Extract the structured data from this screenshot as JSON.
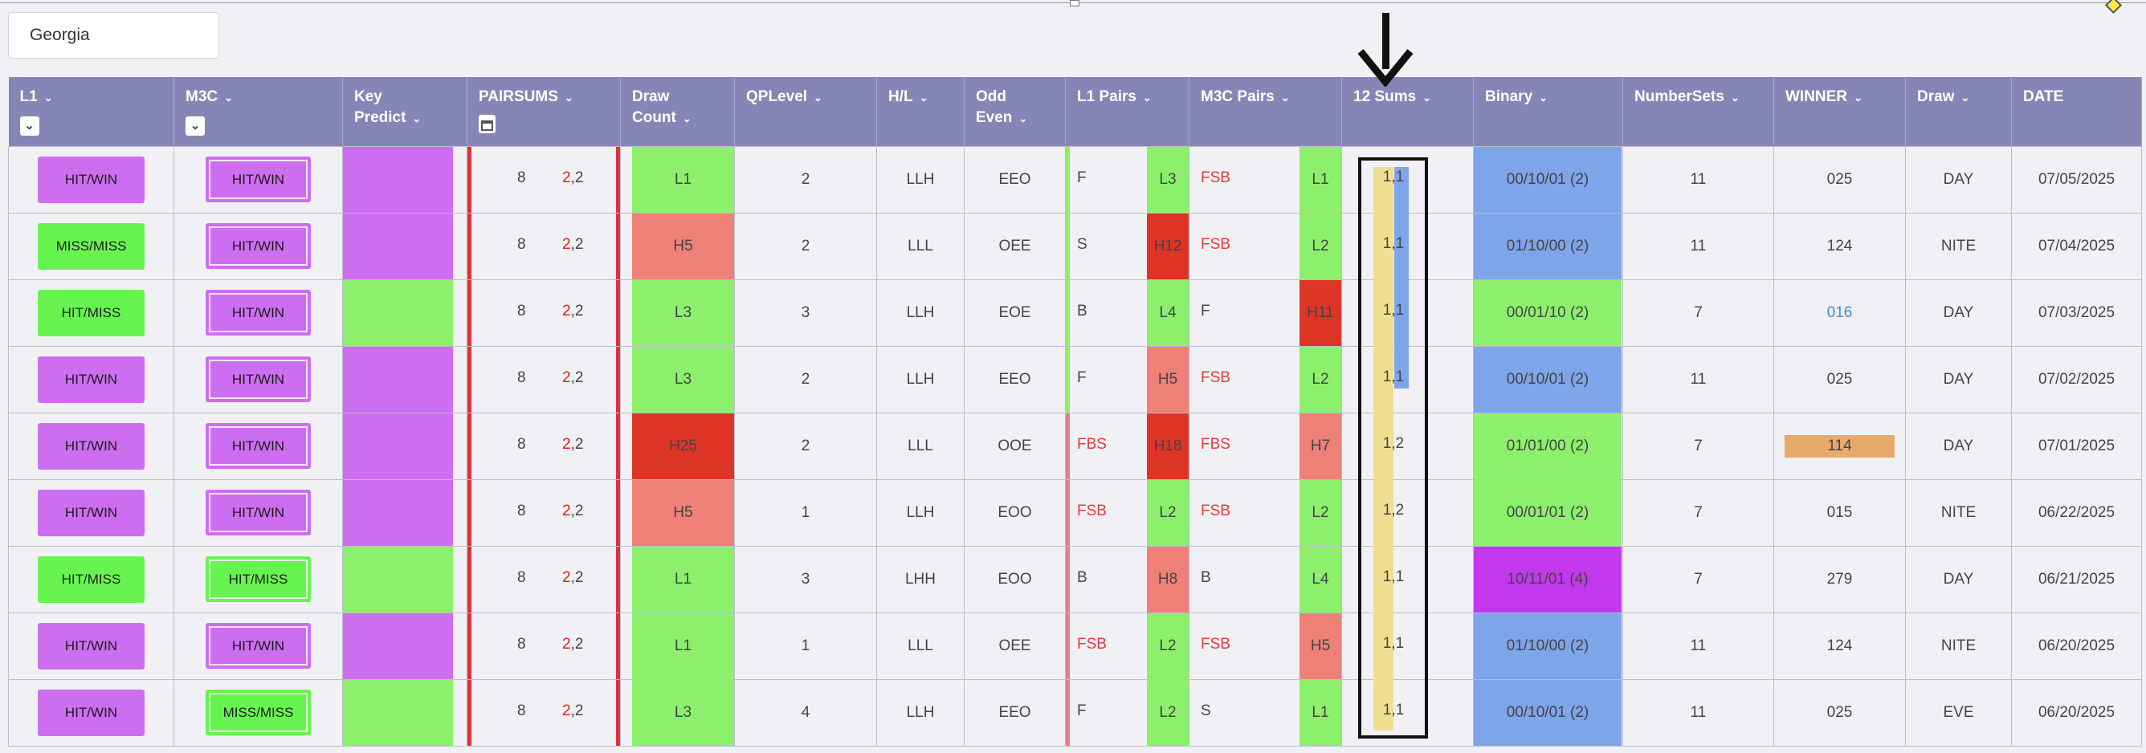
{
  "state_select": {
    "value": "Georgia"
  },
  "headers": [
    {
      "line1": "L1",
      "line2": "",
      "filter": true
    },
    {
      "line1": "M3C",
      "line2": "",
      "filter": true
    },
    {
      "line1": "Key",
      "line2": "Predict"
    },
    {
      "line1": "PAIRSUMS",
      "line2": "",
      "calendar": true
    },
    {
      "line1": "Draw",
      "line2": "Count"
    },
    {
      "line1": "QPLevel",
      "line2": ""
    },
    {
      "line1": "H/L",
      "line2": ""
    },
    {
      "line1": "Odd",
      "line2": "Even"
    },
    {
      "line1": "L1 Pairs",
      "line2": ""
    },
    {
      "line1": "M3C Pairs",
      "line2": ""
    },
    {
      "line1": "12 Sums",
      "line2": ""
    },
    {
      "line1": "Binary",
      "line2": ""
    },
    {
      "line1": "NumberSets",
      "line2": ""
    },
    {
      "line1": "WINNER",
      "line2": ""
    },
    {
      "line1": "Draw",
      "line2": ""
    },
    {
      "line1": "DATE",
      "line2": "",
      "nocaret": true
    }
  ],
  "filter_icon": "chevron-down-icon",
  "calendar_icon": "calendar-icon",
  "rows": [
    {
      "l1": "HIT/WIN",
      "l1c": "purple",
      "m3c": "HIT/WIN",
      "m3cc": "purple",
      "kp": "purple",
      "ps1": "8",
      "ps2a": "2",
      "ps2b": ",2",
      "dc": "L1",
      "dcc": "green",
      "qp": "2",
      "hl": "LLH",
      "oe": "EEO",
      "l1pb": "green",
      "l1p": "F",
      "l1pr": false,
      "l1pv": "L3",
      "l1pvc": "green",
      "m3p": "FSB",
      "m3pr": true,
      "m3pv": "L1",
      "m3pvc": "green",
      "sums": "1,1",
      "bin": "00/10/01 (2)",
      "binc": "blue",
      "ns": "11",
      "win": "025",
      "winc": "",
      "draw": "DAY",
      "date": "07/05/2025"
    },
    {
      "l1": "MISS/MISS",
      "l1c": "green",
      "m3c": "HIT/WIN",
      "m3cc": "purple",
      "kp": "purple",
      "ps1": "8",
      "ps2a": "2",
      "ps2b": ",2",
      "dc": "H5",
      "dcc": "lred",
      "qp": "2",
      "hl": "LLL",
      "oe": "OEE",
      "l1pb": "green",
      "l1p": "S",
      "l1pr": false,
      "l1pv": "H12",
      "l1pvc": "dred",
      "m3p": "FSB",
      "m3pr": true,
      "m3pv": "L2",
      "m3pvc": "green",
      "sums": "1,1",
      "bin": "01/10/00 (2)",
      "binc": "blue",
      "ns": "11",
      "win": "124",
      "winc": "",
      "draw": "NITE",
      "date": "07/04/2025"
    },
    {
      "l1": "HIT/MISS",
      "l1c": "green",
      "m3c": "HIT/WIN",
      "m3cc": "purple",
      "kp": "green",
      "ps1": "8",
      "ps2a": "2",
      "ps2b": ",2",
      "dc": "L3",
      "dcc": "green",
      "qp": "3",
      "hl": "LLH",
      "oe": "EOE",
      "l1pb": "green",
      "l1p": "B",
      "l1pr": false,
      "l1pv": "L4",
      "l1pvc": "green",
      "m3p": "F",
      "m3pr": false,
      "m3pv": "H11",
      "m3pvc": "dred",
      "sums": "1,1",
      "bin": "00/01/10 (2)",
      "binc": "green",
      "ns": "7",
      "win": "016",
      "winc": "link",
      "draw": "DAY",
      "date": "07/03/2025"
    },
    {
      "l1": "HIT/WIN",
      "l1c": "purple",
      "m3c": "HIT/WIN",
      "m3cc": "purple",
      "kp": "purple",
      "ps1": "8",
      "ps2a": "2",
      "ps2b": ",2",
      "dc": "L3",
      "dcc": "green",
      "qp": "2",
      "hl": "LLH",
      "oe": "EEO",
      "l1pb": "green",
      "l1p": "F",
      "l1pr": false,
      "l1pv": "H5",
      "l1pvc": "lred",
      "m3p": "FSB",
      "m3pr": true,
      "m3pv": "L2",
      "m3pvc": "green",
      "sums": "1,1",
      "bin": "00/10/01 (2)",
      "binc": "blue",
      "ns": "11",
      "win": "025",
      "winc": "",
      "draw": "DAY",
      "date": "07/02/2025"
    },
    {
      "l1": "HIT/WIN",
      "l1c": "purple",
      "m3c": "HIT/WIN",
      "m3cc": "purple",
      "kp": "purple",
      "ps1": "8",
      "ps2a": "2",
      "ps2b": ",2",
      "dc": "H25",
      "dcc": "dred",
      "qp": "2",
      "hl": "LLL",
      "oe": "OOE",
      "l1pb": "pink",
      "l1p": "FBS",
      "l1pr": true,
      "l1pv": "H18",
      "l1pvc": "dred",
      "m3p": "FBS",
      "m3pr": true,
      "m3pv": "H7",
      "m3pvc": "lred",
      "sums": "1,2",
      "bin": "01/01/00 (2)",
      "binc": "green",
      "ns": "7",
      "win": "114",
      "winc": "bar",
      "draw": "DAY",
      "date": "07/01/2025"
    },
    {
      "l1": "HIT/WIN",
      "l1c": "purple",
      "m3c": "HIT/WIN",
      "m3cc": "purple",
      "kp": "purple",
      "ps1": "8",
      "ps2a": "2",
      "ps2b": ",2",
      "dc": "H5",
      "dcc": "lred",
      "qp": "1",
      "hl": "LLH",
      "oe": "EOO",
      "l1pb": "pink",
      "l1p": "FSB",
      "l1pr": true,
      "l1pv": "L2",
      "l1pvc": "green",
      "m3p": "FSB",
      "m3pr": true,
      "m3pv": "L2",
      "m3pvc": "green",
      "sums": "1,2",
      "bin": "00/01/01 (2)",
      "binc": "green",
      "ns": "7",
      "win": "015",
      "winc": "",
      "draw": "NITE",
      "date": "06/22/2025"
    },
    {
      "l1": "HIT/MISS",
      "l1c": "green",
      "m3c": "HIT/MISS",
      "m3cc": "green",
      "kp": "green",
      "ps1": "8",
      "ps2a": "2",
      "ps2b": ",2",
      "dc": "L1",
      "dcc": "green",
      "qp": "3",
      "hl": "LHH",
      "oe": "EOO",
      "l1pb": "pink",
      "l1p": "B",
      "l1pr": false,
      "l1pv": "H8",
      "l1pvc": "lred",
      "m3p": "B",
      "m3pr": false,
      "m3pv": "L4",
      "m3pvc": "green",
      "sums": "1,1",
      "bin": "10/11/01 (4)",
      "binc": "mag",
      "ns": "7",
      "win": "279",
      "winc": "",
      "draw": "DAY",
      "date": "06/21/2025"
    },
    {
      "l1": "HIT/WIN",
      "l1c": "purple",
      "m3c": "HIT/WIN",
      "m3cc": "purple",
      "kp": "purple",
      "ps1": "8",
      "ps2a": "2",
      "ps2b": ",2",
      "dc": "L1",
      "dcc": "green",
      "qp": "1",
      "hl": "LLL",
      "oe": "OEE",
      "l1pb": "pink",
      "l1p": "FSB",
      "l1pr": true,
      "l1pv": "L2",
      "l1pvc": "green",
      "m3p": "FSB",
      "m3pr": true,
      "m3pv": "H5",
      "m3pvc": "lred",
      "sums": "1,1",
      "bin": "01/10/00 (2)",
      "binc": "blue",
      "ns": "11",
      "win": "124",
      "winc": "",
      "draw": "NITE",
      "date": "06/20/2025"
    },
    {
      "l1": "HIT/WIN",
      "l1c": "purple",
      "m3c": "MISS/MISS",
      "m3cc": "green",
      "kp": "green",
      "ps1": "8",
      "ps2a": "2",
      "ps2b": ",2",
      "dc": "L3",
      "dcc": "green",
      "qp": "4",
      "hl": "LLH",
      "oe": "EEO",
      "l1pb": "pink",
      "l1p": "F",
      "l1pr": false,
      "l1pv": "L2",
      "l1pvc": "green",
      "m3p": "S",
      "m3pr": false,
      "m3pv": "L1",
      "m3pvc": "green",
      "sums": "1,1",
      "bin": "00/10/01 (2)",
      "binc": "blue",
      "ns": "11",
      "win": "025",
      "winc": "",
      "draw": "EVE",
      "date": "06/20/2025"
    }
  ],
  "annotation": {
    "arrow_icon": "down-arrow-icon"
  }
}
